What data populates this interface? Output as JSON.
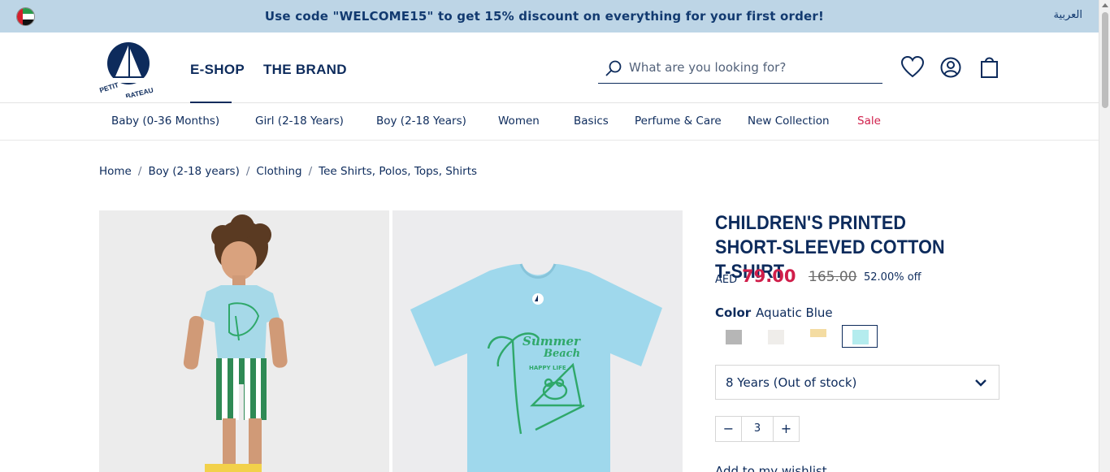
{
  "promo": {
    "text": "Use code \"WELCOME15\" to get 15% discount on everything for your first order!",
    "language_label": "العربية",
    "flag_icon": "uae-flag-icon"
  },
  "header": {
    "logo_text": "PETIT BATEAU",
    "nav": [
      {
        "label": "E-SHOP",
        "active": true
      },
      {
        "label": "THE BRAND",
        "active": false
      }
    ],
    "search_placeholder": "What are you looking for?",
    "icons": [
      "heart-icon",
      "user-icon",
      "shopping-bag-icon"
    ]
  },
  "categories": [
    {
      "label": "Baby (0-36 Months)"
    },
    {
      "label": "Girl (2-18 Years)"
    },
    {
      "label": "Boy (2-18 Years)"
    },
    {
      "label": "Women"
    },
    {
      "label": "Basics"
    },
    {
      "label": "Perfume & Care"
    },
    {
      "label": "New Collection"
    },
    {
      "label": "Sale"
    }
  ],
  "breadcrumb": [
    "Home",
    "Boy (2-18 years)",
    "Clothing",
    "Tee Shirts, Polos, Tops, Shirts"
  ],
  "breadcrumb_separator": "/",
  "product": {
    "title": "CHILDREN'S PRINTED SHORT-SLEEVED COTTON T-SHIRT",
    "currency": "AED",
    "price": "79.00",
    "old_price": "165.00",
    "discount": "52.00% off",
    "color_label": "Color",
    "color_value": "Aquatic Blue",
    "swatches": [
      {
        "color": "#b6b6b6",
        "selected": false
      },
      {
        "color": "#efedea",
        "selected": false
      },
      {
        "color": "#f4dca2",
        "selected": false
      },
      {
        "color": "#b4ecee",
        "selected": true
      }
    ],
    "size_selected": "8 Years (Out of stock)",
    "quantity": "3",
    "qty_minus": "−",
    "qty_plus": "+",
    "wishlist_label": "Add to my wishlist",
    "print_text_line1": "Summer",
    "print_text_line2": "Beach",
    "print_text_line3": "HAPPY LIFE"
  },
  "colors": {
    "navy": "#0d2b5c",
    "sale_red": "#d01e4a",
    "promo_bg": "#bdd5e6",
    "tee_blue": "#9fd8ec",
    "print_green": "#2fa86a"
  }
}
